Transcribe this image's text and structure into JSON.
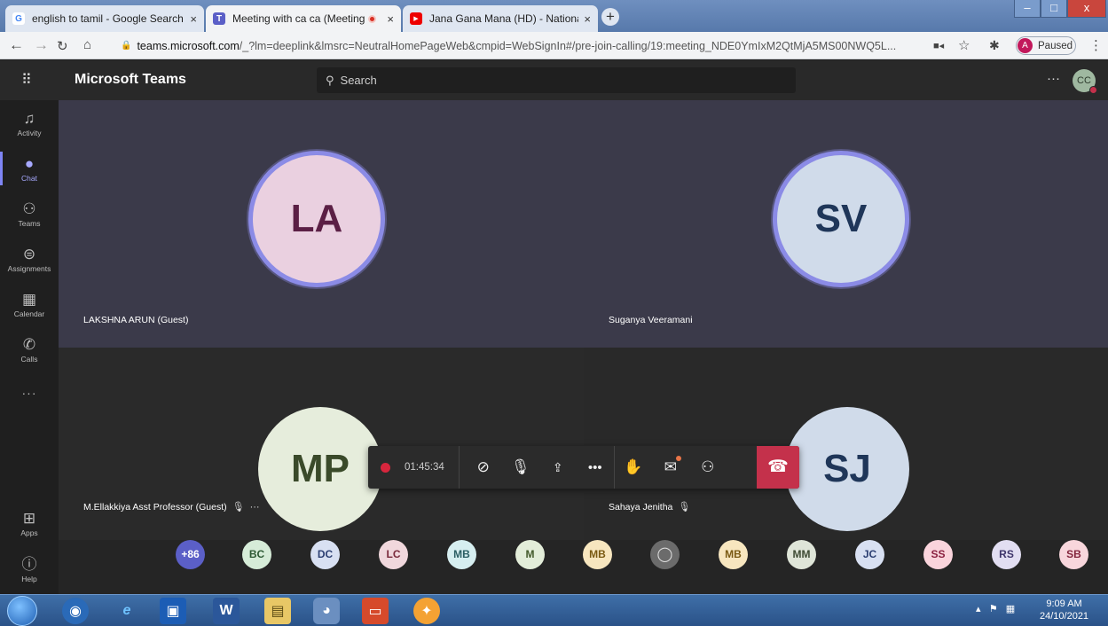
{
  "browser": {
    "tabs": [
      {
        "title": "english to tamil - Google Search",
        "icon": "google-icon",
        "close": "×"
      },
      {
        "title": "Meeting with ca ca (Meeting",
        "icon": "teams-icon",
        "close": "×"
      },
      {
        "title": "Jana Gana Mana (HD) - National",
        "icon": "youtube-icon",
        "close": "×"
      }
    ],
    "new_tab": "+",
    "window_controls": [
      "–",
      "□",
      "x"
    ],
    "url_host": "teams.microsoft.com",
    "url_path": "/_?lm=deeplink&lmsrc=NeutralHomePageWeb&cmpid=WebSignIn#/pre-join-calling/19:meeting_NDE0YmIxM2QtMjA5MS00NWQ5L...",
    "profile_initial": "A",
    "profile_status": "Paused"
  },
  "teams": {
    "app_title": "Microsoft Teams",
    "search_placeholder": "Search",
    "more": "···",
    "me_initials": "CC",
    "rail": [
      {
        "label": "Activity",
        "icon": "bell-icon"
      },
      {
        "label": "Chat",
        "icon": "chat-icon"
      },
      {
        "label": "Teams",
        "icon": "teams-icon"
      },
      {
        "label": "Assignments",
        "icon": "assignments-icon"
      },
      {
        "label": "Calendar",
        "icon": "calendar-icon"
      },
      {
        "label": "Calls",
        "icon": "phone-icon"
      }
    ],
    "rail_more": "···",
    "rail_bottom": [
      {
        "label": "Apps",
        "icon": "apps-icon"
      },
      {
        "label": "Help",
        "icon": "help-icon"
      }
    ]
  },
  "participants": [
    {
      "initials": "LA",
      "name": "LAKSHNA ARUN (Guest)",
      "bg": "#ead0e0",
      "fg": "#5b1f45",
      "speaking": true
    },
    {
      "initials": "SV",
      "name": "Suganya Veeramani",
      "bg": "#d0dbea",
      "fg": "#1f3659",
      "speaking": true
    },
    {
      "initials": "MP",
      "name": "M.Ellakkiya Asst Professor (Guest)",
      "bg": "#e6eddc",
      "fg": "#3a4a2a",
      "speaking": false
    },
    {
      "initials": "SJ",
      "name": "Sahaya Jenitha",
      "bg": "#d0dbea",
      "fg": "#1f3659",
      "speaking": false
    }
  ],
  "tile_more": "···",
  "call": {
    "timer": "01:45:34"
  },
  "roster": [
    {
      "label": "+86",
      "bg": "#5b5fc7",
      "fg": "#ffffff"
    },
    {
      "label": "BC",
      "bg": "#d6ecd8",
      "fg": "#2d5a34"
    },
    {
      "label": "DC",
      "bg": "#d8e0f2",
      "fg": "#2c3f72"
    },
    {
      "label": "LC",
      "bg": "#f0d7dc",
      "fg": "#7a2a3b"
    },
    {
      "label": "MB",
      "bg": "#d6eef0",
      "fg": "#2b5e63"
    },
    {
      "label": "M",
      "bg": "#e3edd9",
      "fg": "#445a2c"
    },
    {
      "label": "MB",
      "bg": "#f7e6bf",
      "fg": "#7a5a13"
    },
    {
      "label": "",
      "bg": "#6b6b6b",
      "fg": "#e0e0e0",
      "icon": "person-icon"
    },
    {
      "label": "MB",
      "bg": "#f7e6bf",
      "fg": "#7a5a13"
    },
    {
      "label": "MM",
      "bg": "#dfe5d8",
      "fg": "#3e4b34"
    },
    {
      "label": "JC",
      "bg": "#d8e0f2",
      "fg": "#2c3f72"
    },
    {
      "label": "SS",
      "bg": "#fad4dc",
      "fg": "#8a2040"
    },
    {
      "label": "RS",
      "bg": "#e2def2",
      "fg": "#3f356b"
    },
    {
      "label": "SB",
      "bg": "#f8d6dc",
      "fg": "#84263e"
    }
  ],
  "taskbar": {
    "time": "9:09 AM",
    "date": "24/10/2021"
  }
}
